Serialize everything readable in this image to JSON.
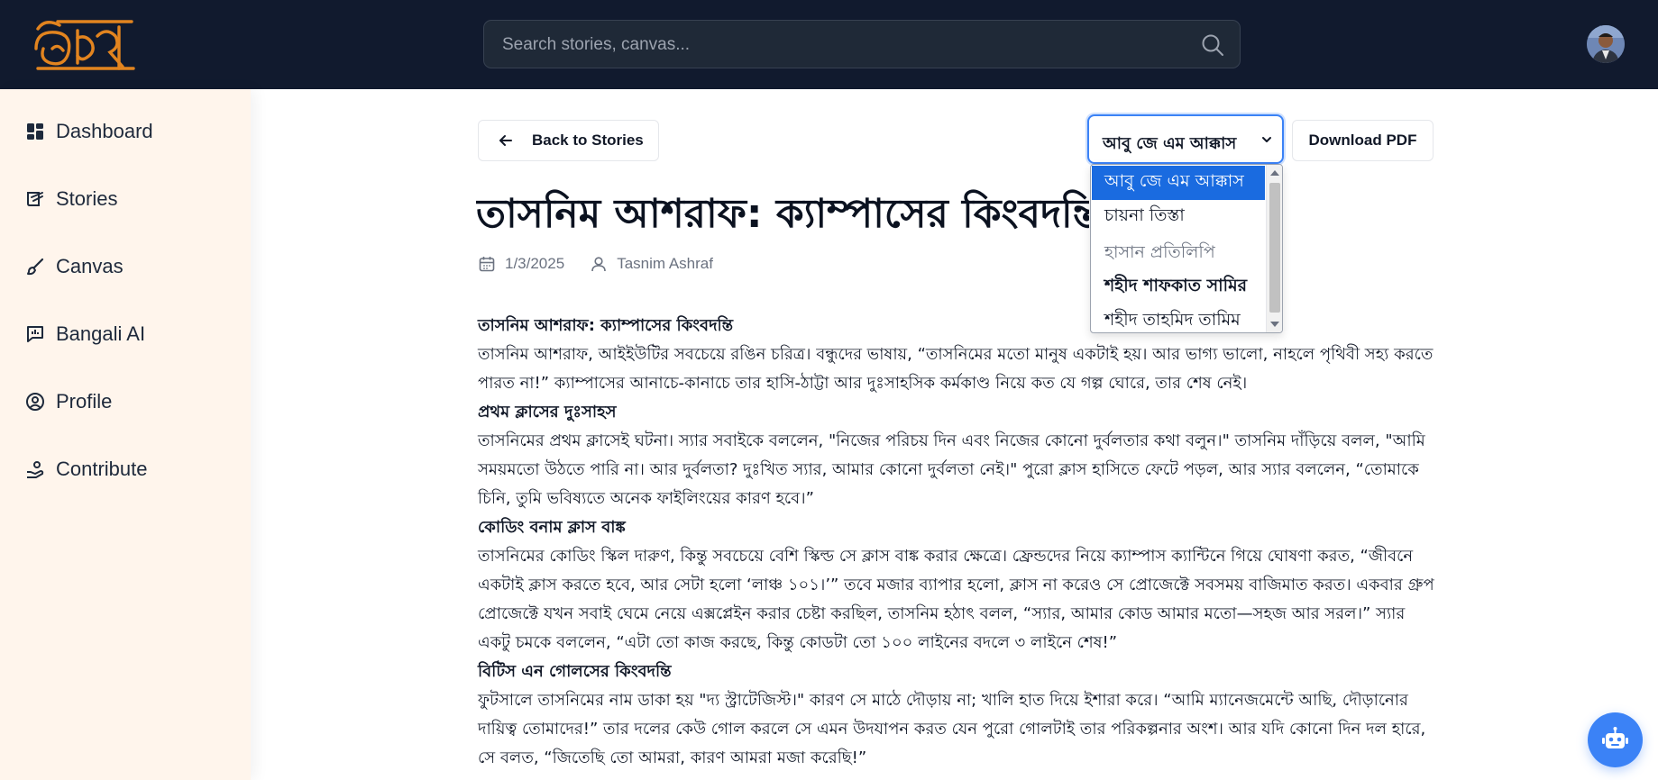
{
  "app": {
    "logo_text": "অক্ষর"
  },
  "search": {
    "placeholder": "Search stories, canvas..."
  },
  "sidebar": {
    "items": [
      {
        "label": "Dashboard",
        "icon": "dashboard-icon"
      },
      {
        "label": "Stories",
        "icon": "stories-icon"
      },
      {
        "label": "Canvas",
        "icon": "brush-icon"
      },
      {
        "label": "Bangali AI",
        "icon": "chat-chart-icon"
      },
      {
        "label": "Profile",
        "icon": "user-circle-icon"
      },
      {
        "label": "Contribute",
        "icon": "contribute-icon"
      }
    ]
  },
  "toolbar": {
    "back_label": "Back to Stories",
    "font_selected": "আবু জে এম আক্কাস",
    "download_label": "Download PDF"
  },
  "font_dropdown": {
    "options": [
      "আবু জে এম আক্কাস",
      "চায়না তিস্তা",
      "হাসান প্রতিলিপি",
      "শহীদ শাফকাত সামির",
      "শহীদ তাহমিদ তামিম"
    ],
    "selected_index": 0
  },
  "story": {
    "title": "তাসনিম আশরাফ: ক্যাম্পাসের কিংবদন্তি",
    "date": "1/3/2025",
    "author": "Tasnim Ashraf",
    "blocks": [
      {
        "type": "h",
        "text": "তাসনিম আশরাফ: ক্যাম্পাসের কিংবদন্তি"
      },
      {
        "type": "p",
        "text": "তাসনিম আশরাফ, আইইউটির সবচেয়ে রঙিন চরিত্র। বন্ধুদের ভাষায়, “তাসনিমের মতো মানুষ একটাই হয়। আর ভাগ্য ভালো, নাহলে পৃথিবী সহ্য করতে পারত না!” ক্যাম্পাসের আনাচে-কানাচে তার হাসি-ঠাট্টা আর দুঃসাহসিক কর্মকাণ্ড নিয়ে কত যে গল্প ঘোরে, তার শেষ নেই।"
      },
      {
        "type": "h",
        "text": "প্রথম ক্লাসের দুঃসাহস"
      },
      {
        "type": "p",
        "text": "তাসনিমের প্রথম ক্লাসেই ঘটনা। স্যার সবাইকে বললেন, \"নিজের পরিচয় দিন এবং নিজের কোনো দুর্বলতার কথা বলুন।\" তাসনিম দাঁড়িয়ে বলল, \"আমি সময়মতো উঠতে পারি না। আর দুর্বলতা? দুঃখিত স্যার, আমার কোনো দুর্বলতা নেই।\" পুরো ক্লাস হাসিতে ফেটে পড়ল, আর স্যার বললেন, “তোমাকে চিনি, তুমি ভবিষ্যতে অনেক ফাইলিংয়ের কারণ হবে।”"
      },
      {
        "type": "h",
        "text": "কোডিং বনাম ক্লাস বাঙ্ক"
      },
      {
        "type": "p",
        "text": "তাসনিমের কোডিং স্কিল দারুণ, কিন্তু সবচেয়ে বেশি স্কিল্ড সে ক্লাস বাঙ্ক করার ক্ষেত্রে। ফ্রেন্ডদের নিয়ে ক্যাম্পাস ক্যান্টিনে গিয়ে ঘোষণা করত, “জীবনে একটাই ক্লাস করতে হবে, আর সেটা হলো ‘লাঞ্চ ১০১।’” তবে মজার ব্যাপার হলো, ক্লাস না করেও সে প্রোজেক্টে সবসময় বাজিমাত করত। একবার গ্রুপ প্রোজেক্টে যখন সবাই ঘেমে নেয়ে এক্সপ্লেইন করার চেষ্টা করছিল, তাসনিম হঠাৎ বলল, “স্যার, আমার কোড আমার মতো—সহজ আর সরল।” স্যার একটু চমকে বললেন, “এটা তো কাজ করছে, কিন্তু কোডটা তো ১০০ লাইনের বদলে ৩ লাইনে শেষ!”"
      },
      {
        "type": "h",
        "text": "বিটিস এন গোলসের কিংবদন্তি"
      },
      {
        "type": "p",
        "text": "ফুটসালে তাসনিমের নাম ডাকা হয় \"দ্য স্ট্রাটেজিস্ট।\" কারণ সে মাঠে দৌড়ায় না; খালি হাত দিয়ে ইশারা করে। “আমি ম্যানেজমেন্টে আছি, দৌড়ানোর দায়িত্ব তোমাদের!” তার দলের কেউ গোল করলে সে এমন উদযাপন করত যেন পুরো গোলটাই তার পরিকল্পনার অংশ। আর যদি কোনো দিন দল হারে, সে বলত, “জিতেছি তো আমরা, কারণ আমরা মজা করেছি!”"
      }
    ]
  },
  "assistant": {
    "icon": "robot-icon"
  },
  "colors": {
    "header_bg": "#111a2e",
    "sidebar_bg": "#fff5ec",
    "accent": "#3b82f6",
    "logo": "#e2841f"
  }
}
